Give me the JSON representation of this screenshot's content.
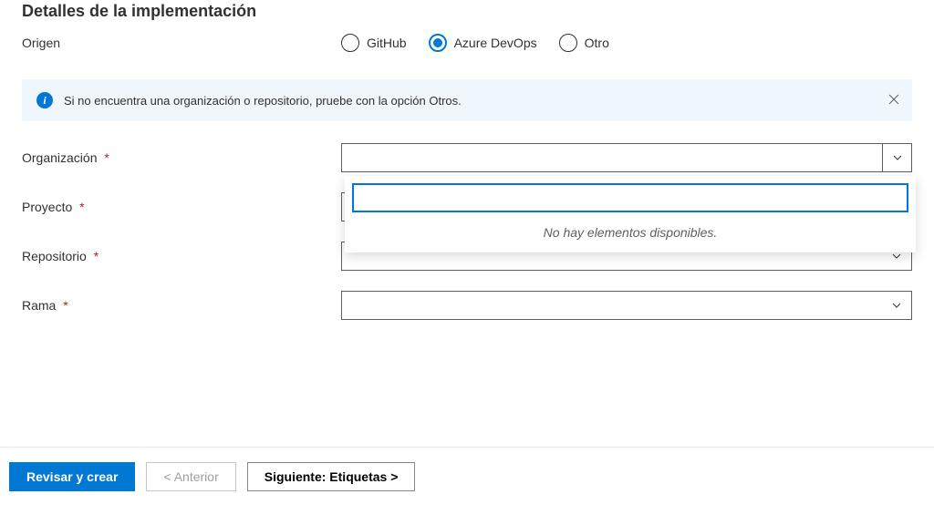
{
  "section_title": "Detalles de la implementación",
  "origin": {
    "label": "Origen",
    "options": [
      {
        "label": "GitHub",
        "selected": false
      },
      {
        "label": "Azure DevOps",
        "selected": true
      },
      {
        "label": "Otro",
        "selected": false
      }
    ]
  },
  "info_banner": {
    "text": "Si no encuentra una organización o repositorio, pruebe con la opción Otros."
  },
  "fields": {
    "organization": {
      "label": "Organización",
      "required": "*",
      "value": ""
    },
    "project": {
      "label": "Proyecto",
      "required": "*",
      "value": ""
    },
    "repository": {
      "label": "Repositorio",
      "required": "*",
      "value": ""
    },
    "branch": {
      "label": "Rama",
      "required": "*",
      "value": ""
    }
  },
  "combo": {
    "search_value": "",
    "empty_text": "No hay elementos disponibles."
  },
  "footer": {
    "review_create": "Revisar y crear",
    "previous": "< Anterior",
    "next": "Siguiente: Etiquetas >"
  }
}
